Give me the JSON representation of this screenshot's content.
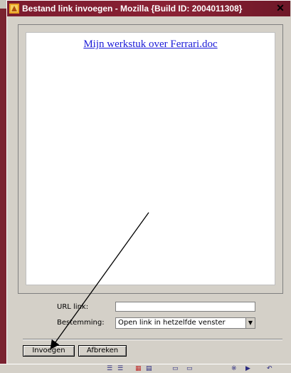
{
  "window": {
    "title": "Bestand link invoegen - Mozilla {Build ID: 2004011308}",
    "close_label": "✕"
  },
  "preview": {
    "link_text": "Mijn werkstuk over Ferrari.doc"
  },
  "form": {
    "url_label": "URL link:",
    "url_value": "",
    "target_label": "Bestemming:",
    "target_selected": "Open link in hetzelfde venster"
  },
  "buttons": {
    "insert_label": "Invoegen",
    "cancel_label": "Afbreken"
  },
  "colors": {
    "titlebar": "#7b1b2e",
    "link": "#1a1ad8",
    "dialog_bg": "#d4d0c8"
  },
  "taskbar": {
    "icons": [
      "list-bullets-icon",
      "list-numbers-icon",
      "table-icon",
      "image-icon",
      "link-icon",
      "anchor-icon",
      "special-char-icon",
      "play-icon",
      "undo-icon"
    ]
  }
}
